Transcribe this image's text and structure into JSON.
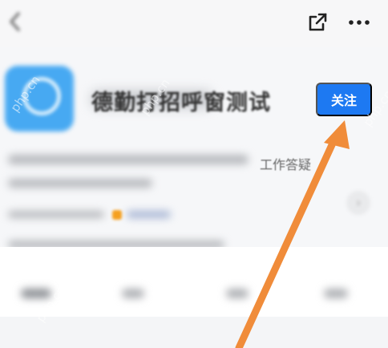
{
  "header": {
    "account_name": "德勤打招呼窗测试",
    "follow_label": "关注"
  },
  "profile": {
    "description_visible": "工作答疑"
  },
  "icons": {
    "back": "chevron-left-icon",
    "share": "share-external-icon",
    "more": "more-horizontal-icon"
  },
  "colors": {
    "follow_button": "#1d79f2",
    "annotation_arrow": "#f08c3a"
  }
}
